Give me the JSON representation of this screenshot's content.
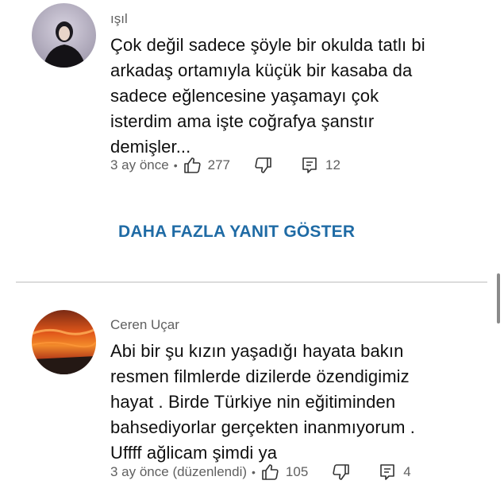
{
  "comments": [
    {
      "author": "ışıl",
      "text": "Çok değil sadece şöyle bir okulda tatlı bi\narkadaş ortamıyla küçük bir kasaba da\nsadece eğlencesine yaşamayı çok\nisterdim ama işte coğrafya şanstır\ndemişler...",
      "time": "3 ay önce",
      "likes": "277",
      "replies": "12"
    },
    {
      "author": "Ceren Uçar",
      "text": "Abi bir şu kızın yaşadığı hayata bakın\nresmen filmlerde dizilerde özendigimiz\nhayat . Birde Türkiye nin eğitiminden\nbahsediyorlar gerçekten inanmıyorum .\nUffff ağlicam şimdi ya",
      "time": "3 ay önce (düzenlendi)",
      "likes": "105",
      "replies": "4"
    }
  ],
  "show_more_replies": "DAHA FAZLA YANIT GÖSTER",
  "icons": {
    "like": "thumb-up-icon",
    "dislike": "thumb-down-icon",
    "reply": "reply-icon"
  }
}
